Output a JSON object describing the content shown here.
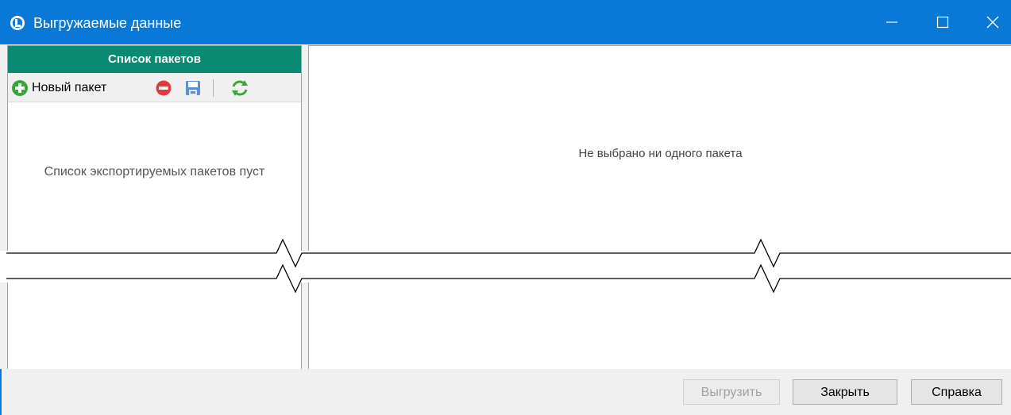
{
  "window": {
    "title": "Выгружаемые данные",
    "icons": {
      "app": "app-logo-icon",
      "minimize": "minimize-icon",
      "maximize": "maximize-icon",
      "close": "close-icon"
    }
  },
  "left_panel": {
    "header": "Список пакетов",
    "toolbar": {
      "new_label": "Новый пакет",
      "icons": [
        "add-circle-icon",
        "delete-circle-icon",
        "save-icon",
        "refresh-icon"
      ]
    },
    "empty_text": "Список экспортируемых пакетов пуст"
  },
  "right_panel": {
    "empty_text": "Не выбрано ни одного пакета"
  },
  "footer": {
    "export_label": "Выгрузить",
    "close_label": "Закрыть",
    "help_label": "Справка"
  },
  "colors": {
    "titlebar": "#0a78d7",
    "panel_header": "#0a8a72",
    "add_icon": "#3aa63a",
    "delete_icon": "#e0393e",
    "refresh_icon": "#3aa63a"
  }
}
